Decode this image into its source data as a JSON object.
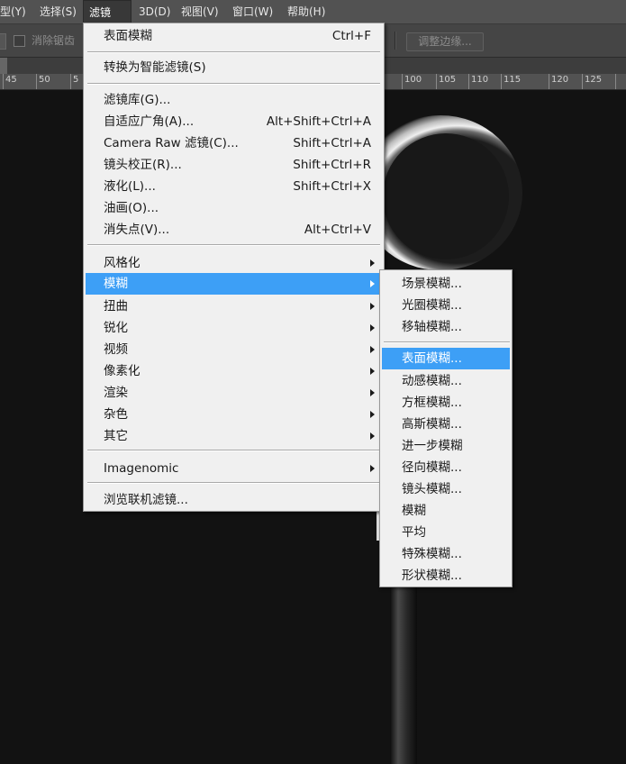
{
  "menubar": {
    "items": [
      {
        "label": "型(Y)"
      },
      {
        "label": "选择(S)"
      },
      {
        "label": "滤镜(T)",
        "active": true
      },
      {
        "label": "3D(D)"
      },
      {
        "label": "视图(V)"
      },
      {
        "label": "窗口(W)"
      },
      {
        "label": "帮助(H)"
      }
    ]
  },
  "options_bar": {
    "antialias_label": "消除锯齿",
    "refine_edge_label": "调整边缘..."
  },
  "ruler": {
    "labels": [
      "45",
      "50",
      "5",
      "100",
      "105",
      "110",
      "115",
      "120",
      "125"
    ]
  },
  "filter_menu": {
    "items": [
      {
        "label": "表面模糊",
        "shortcut": "Ctrl+F"
      },
      {
        "label": "转换为智能滤镜(S)"
      },
      {
        "label": "滤镜库(G)..."
      },
      {
        "label": "自适应广角(A)...",
        "shortcut": "Alt+Shift+Ctrl+A"
      },
      {
        "label": "Camera Raw 滤镜(C)...",
        "shortcut": "Shift+Ctrl+A"
      },
      {
        "label": "镜头校正(R)...",
        "shortcut": "Shift+Ctrl+R"
      },
      {
        "label": "液化(L)...",
        "shortcut": "Shift+Ctrl+X"
      },
      {
        "label": "油画(O)..."
      },
      {
        "label": "消失点(V)...",
        "shortcut": "Alt+Ctrl+V"
      },
      {
        "label": "风格化"
      },
      {
        "label": "模糊"
      },
      {
        "label": "扭曲"
      },
      {
        "label": "锐化"
      },
      {
        "label": "视频"
      },
      {
        "label": "像素化"
      },
      {
        "label": "渲染"
      },
      {
        "label": "杂色"
      },
      {
        "label": "其它"
      },
      {
        "label": "Imagenomic"
      },
      {
        "label": "浏览联机滤镜..."
      }
    ]
  },
  "blur_submenu": {
    "items": [
      {
        "label": "场景模糊..."
      },
      {
        "label": "光圈模糊..."
      },
      {
        "label": "移轴模糊..."
      },
      {
        "label": "表面模糊..."
      },
      {
        "label": "动感模糊..."
      },
      {
        "label": "方框模糊..."
      },
      {
        "label": "高斯模糊..."
      },
      {
        "label": "进一步模糊"
      },
      {
        "label": "径向模糊..."
      },
      {
        "label": "镜头模糊..."
      },
      {
        "label": "模糊"
      },
      {
        "label": "平均"
      },
      {
        "label": "特殊模糊..."
      },
      {
        "label": "形状模糊..."
      }
    ]
  },
  "colors": {
    "menu_highlight": "#3d9ff6",
    "menu_background": "#f0f0f0",
    "canvas_background": "#121212"
  }
}
